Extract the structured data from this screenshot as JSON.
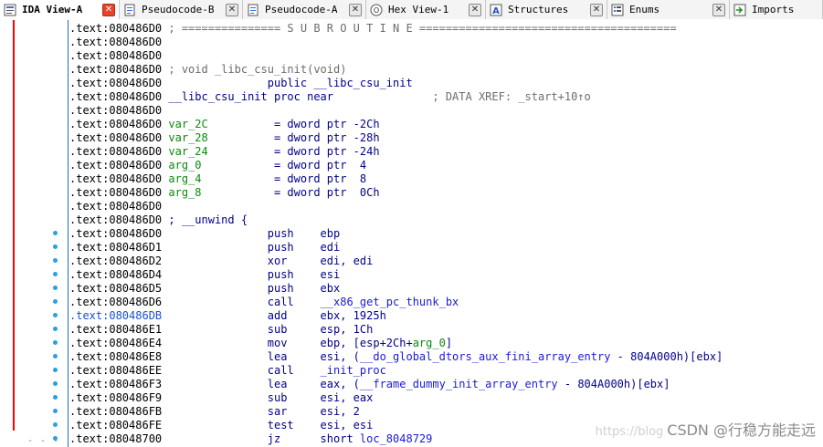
{
  "tabs": [
    {
      "label": "IDA View-A",
      "icon": "ida-view-icon",
      "active": true
    },
    {
      "label": "Pseudocode-B",
      "icon": "pseudocode-icon",
      "active": false
    },
    {
      "label": "Pseudocode-A",
      "icon": "pseudocode-icon",
      "active": false
    },
    {
      "label": "Hex View-1",
      "icon": "hex-view-icon",
      "active": false
    },
    {
      "label": "Structures",
      "icon": "structures-icon",
      "active": false
    },
    {
      "label": "Enums",
      "icon": "enums-icon",
      "active": false
    },
    {
      "label": "Imports",
      "icon": "imports-icon",
      "active": false
    }
  ],
  "listing": [
    {
      "addr": ".text:080486D0",
      "segs": [
        {
          "t": " ; =============== S U B R O U T I N E =======================================",
          "c": "comment"
        }
      ]
    },
    {
      "addr": ".text:080486D0",
      "segs": []
    },
    {
      "addr": ".text:080486D0",
      "segs": []
    },
    {
      "addr": ".text:080486D0",
      "segs": [
        {
          "t": " ; void _libc_csu_init(void)",
          "c": "comment"
        }
      ]
    },
    {
      "addr": ".text:080486D0",
      "segs": [
        {
          "t": "                ",
          "c": "black"
        },
        {
          "t": "public __libc_csu_init",
          "c": "navy"
        }
      ]
    },
    {
      "addr": ".text:080486D0",
      "segs": [
        {
          "t": " __libc_csu_init proc near",
          "c": "navy"
        },
        {
          "t": "               ; DATA XREF: _start+10↑o",
          "c": "comment"
        }
      ]
    },
    {
      "addr": ".text:080486D0",
      "segs": []
    },
    {
      "addr": ".text:080486D0",
      "segs": [
        {
          "t": " var_2C",
          "c": "green"
        },
        {
          "t": "          = dword ptr -2Ch",
          "c": "navy"
        }
      ]
    },
    {
      "addr": ".text:080486D0",
      "segs": [
        {
          "t": " var_28",
          "c": "green"
        },
        {
          "t": "          = dword ptr -28h",
          "c": "navy"
        }
      ]
    },
    {
      "addr": ".text:080486D0",
      "segs": [
        {
          "t": " var_24",
          "c": "green"
        },
        {
          "t": "          = dword ptr -24h",
          "c": "navy"
        }
      ]
    },
    {
      "addr": ".text:080486D0",
      "segs": [
        {
          "t": " arg_0",
          "c": "green"
        },
        {
          "t": "           = dword ptr  4",
          "c": "navy"
        }
      ]
    },
    {
      "addr": ".text:080486D0",
      "segs": [
        {
          "t": " arg_4",
          "c": "green"
        },
        {
          "t": "           = dword ptr  8",
          "c": "navy"
        }
      ]
    },
    {
      "addr": ".text:080486D0",
      "segs": [
        {
          "t": " arg_8",
          "c": "green"
        },
        {
          "t": "           = dword ptr  0Ch",
          "c": "navy"
        }
      ]
    },
    {
      "addr": ".text:080486D0",
      "segs": []
    },
    {
      "addr": ".text:080486D0",
      "segs": [
        {
          "t": " ; __unwind {",
          "c": "navy"
        }
      ]
    },
    {
      "addr": ".text:080486D0",
      "segs": [
        {
          "t": "                push    ebp",
          "c": "navy"
        }
      ]
    },
    {
      "addr": ".text:080486D1",
      "segs": [
        {
          "t": "                push    edi",
          "c": "navy"
        }
      ]
    },
    {
      "addr": ".text:080486D2",
      "segs": [
        {
          "t": "                xor     edi, edi",
          "c": "navy"
        }
      ]
    },
    {
      "addr": ".text:080486D4",
      "segs": [
        {
          "t": "                push    esi",
          "c": "navy"
        }
      ]
    },
    {
      "addr": ".text:080486D5",
      "segs": [
        {
          "t": "                push    ebx",
          "c": "navy"
        }
      ]
    },
    {
      "addr": ".text:080486D6",
      "segs": [
        {
          "t": "                call    ",
          "c": "navy"
        },
        {
          "t": "__x86_get_pc_thunk_bx",
          "c": "blue"
        }
      ]
    },
    {
      "addr": ".text:080486DB",
      "hl": true,
      "segs": [
        {
          "t": "                add     ebx, 1925h",
          "c": "navy"
        }
      ]
    },
    {
      "addr": ".text:080486E1",
      "segs": [
        {
          "t": "                sub     esp, 1Ch",
          "c": "navy"
        }
      ]
    },
    {
      "addr": ".text:080486E4",
      "segs": [
        {
          "t": "                mov     ebp, [esp+2Ch+",
          "c": "navy"
        },
        {
          "t": "arg_0",
          "c": "green"
        },
        {
          "t": "]",
          "c": "navy"
        }
      ]
    },
    {
      "addr": ".text:080486E8",
      "segs": [
        {
          "t": "                lea     esi, (",
          "c": "navy"
        },
        {
          "t": "__do_global_dtors_aux_fini_array_entry",
          "c": "blue"
        },
        {
          "t": " - 804A000h)[ebx]",
          "c": "navy"
        }
      ]
    },
    {
      "addr": ".text:080486EE",
      "segs": [
        {
          "t": "                call    ",
          "c": "navy"
        },
        {
          "t": "_init_proc",
          "c": "blue"
        }
      ]
    },
    {
      "addr": ".text:080486F3",
      "segs": [
        {
          "t": "                lea     eax, (",
          "c": "navy"
        },
        {
          "t": "__frame_dummy_init_array_entry",
          "c": "blue"
        },
        {
          "t": " - 804A000h)[ebx]",
          "c": "navy"
        }
      ]
    },
    {
      "addr": ".text:080486F9",
      "segs": [
        {
          "t": "                sub     esi, eax",
          "c": "navy"
        }
      ]
    },
    {
      "addr": ".text:080486FB",
      "segs": [
        {
          "t": "                sar     esi, 2",
          "c": "navy"
        }
      ]
    },
    {
      "addr": ".text:080486FE",
      "segs": [
        {
          "t": "                test    esi, esi",
          "c": "navy"
        }
      ]
    },
    {
      "addr": ".text:08048700",
      "segs": [
        {
          "t": "                jz      short ",
          "c": "navy"
        },
        {
          "t": "loc_8048729",
          "c": "blue"
        }
      ]
    }
  ],
  "watermark": {
    "faint": "https://blog",
    "text": "CSDN @行稳方能走远"
  },
  "colors": {
    "accent_red": "#ff0000",
    "dot_blue": "#27a0e8",
    "active_close": "#e8412c"
  }
}
